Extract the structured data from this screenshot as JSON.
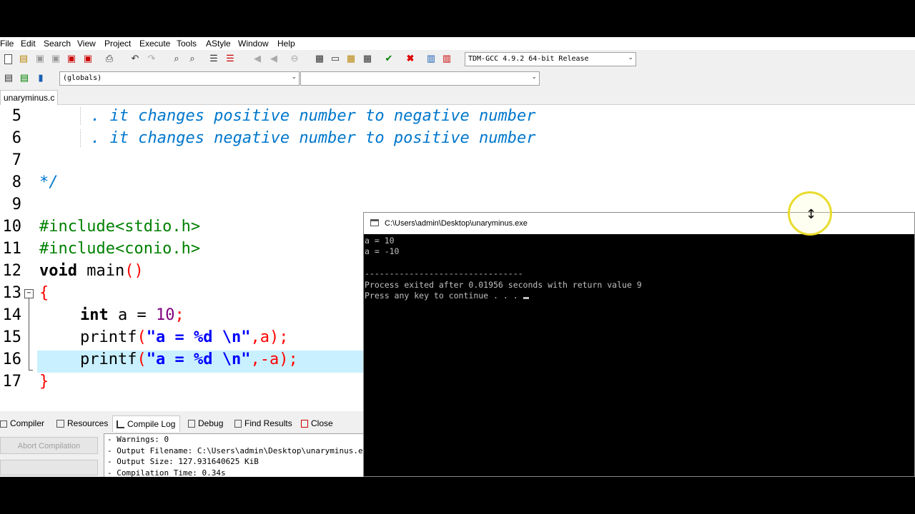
{
  "menu": [
    "File",
    "Edit",
    "Search",
    "View",
    "Project",
    "Execute",
    "Tools",
    "AStyle",
    "Window",
    "Help"
  ],
  "toolbar": {
    "compiler_select": "TDM-GCC 4.9.2 64-bit Release",
    "scope_select": "(globals)",
    "members_select": ""
  },
  "file_tab": "unaryminus.c",
  "editor": {
    "line_numbers": [
      "5",
      "6",
      "7",
      "8",
      "9",
      "10",
      "11",
      "12",
      "13",
      "14",
      "15",
      "16",
      "17"
    ],
    "comment_line_5": ". it changes positive number to negative number",
    "comment_line_6": ". it changes negative number to positive number",
    "comment_end": "*/",
    "include_1": "#include<stdio.h>",
    "include_2": "#include<conio.h>",
    "void_kw": "void",
    "main_fn": " main",
    "main_paren": "()",
    "open_brace": "{",
    "int_kw": "int",
    "a_decl": " a = ",
    "ten": "10",
    "semi": ";",
    "printf": "printf",
    "lparen": "(",
    "fmt_str": "\"a = %d ",
    "esc_n": "\\n",
    "quote": "\"",
    "arg_a": ",a",
    "arg_neg_a": ",-a",
    "rparen": ")",
    "close_brace": "}"
  },
  "bottom_tabs": [
    "Compiler",
    "Resources",
    "Compile Log",
    "Debug",
    "Find Results",
    "Close"
  ],
  "active_bottom_tab": "Compile Log",
  "abort_button": "Abort Compilation",
  "compile_log": [
    "- Warnings: 0",
    "- Output Filename: C:\\Users\\admin\\Desktop\\unaryminus.exe",
    "- Output Size: 127.931640625 KiB",
    "- Compilation Time: 0.34s"
  ],
  "console": {
    "title": "C:\\Users\\admin\\Desktop\\unaryminus.exe",
    "lines": [
      "a = 10",
      "a = -10",
      "",
      "--------------------------------",
      "Process exited after 0.01956 seconds with return value 9",
      "Press any key to continue . . . "
    ]
  }
}
